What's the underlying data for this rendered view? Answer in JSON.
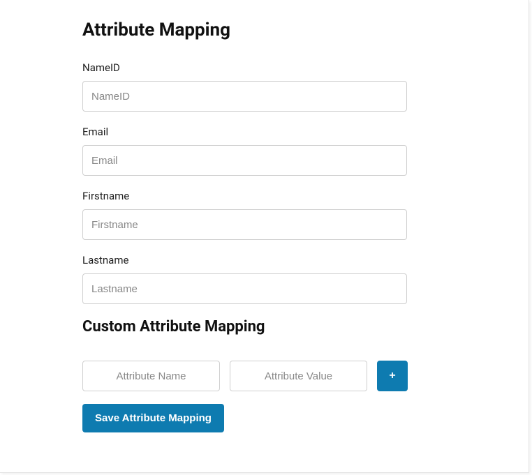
{
  "headings": {
    "main": "Attribute Mapping",
    "custom": "Custom Attribute Mapping"
  },
  "fields": {
    "nameid": {
      "label": "NameID",
      "placeholder": "NameID",
      "value": ""
    },
    "email": {
      "label": "Email",
      "placeholder": "Email",
      "value": ""
    },
    "firstname": {
      "label": "Firstname",
      "placeholder": "Firstname",
      "value": ""
    },
    "lastname": {
      "label": "Lastname",
      "placeholder": "Lastname",
      "value": ""
    }
  },
  "custom": {
    "name_placeholder": "Attribute Name",
    "value_placeholder": "Attribute Value",
    "add_label": "+"
  },
  "buttons": {
    "save": "Save Attribute Mapping"
  }
}
